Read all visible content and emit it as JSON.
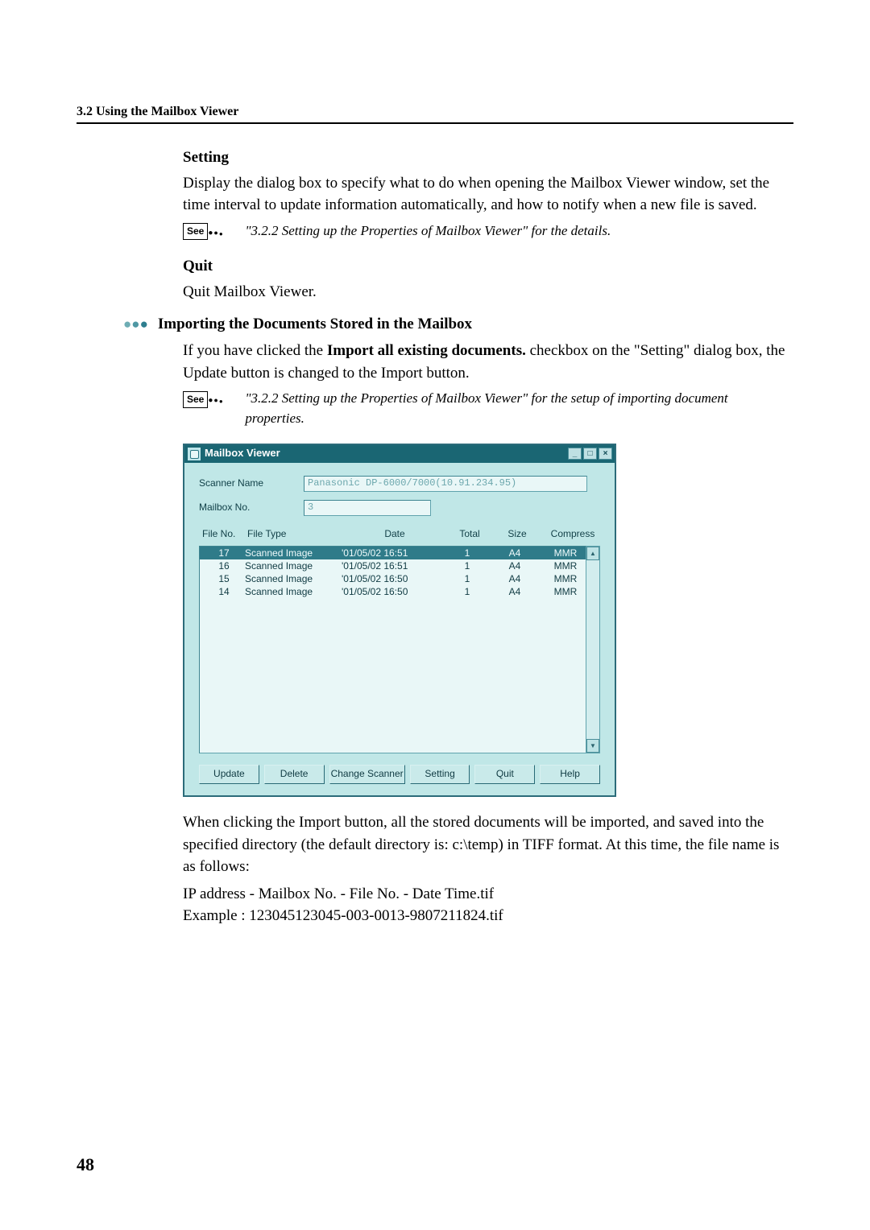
{
  "page": {
    "section_header": "3.2  Using the Mailbox Viewer",
    "page_number": "48"
  },
  "setting": {
    "heading": "Setting",
    "body": "Display the dialog box to specify what to do when opening the Mailbox Viewer window, set the time interval to update information automatically, and how to notify when a new file is saved.",
    "see_label": "See",
    "see_text": "\"3.2.2  Setting up the Properties of Mailbox Viewer\" for the details."
  },
  "quit": {
    "heading": "Quit",
    "body": "Quit Mailbox Viewer."
  },
  "importing": {
    "heading": "Importing the Documents Stored in the Mailbox",
    "body_pre": "If you have clicked the ",
    "body_bold": "Import all existing documents.",
    "body_post": " checkbox on the \"Setting\" dialog box, the Update button is changed to the Import button.",
    "see_label": "See",
    "see_text": "\"3.2.2  Setting up the Properties of Mailbox Viewer\" for the setup of  importing document properties."
  },
  "mbv": {
    "title": "Mailbox Viewer",
    "scanner_name_label": "Scanner Name",
    "scanner_name_value": "Panasonic DP-6000/7000(10.91.234.95)",
    "mailbox_no_label": "Mailbox No.",
    "mailbox_no_value": "3",
    "columns": {
      "file_no": "File No.",
      "file_type": "File Type",
      "date": "Date",
      "total": "Total",
      "size": "Size",
      "compress": "Compress"
    },
    "rows": [
      {
        "no": "17",
        "type": "Scanned Image",
        "date": "'01/05/02 16:51",
        "total": "1",
        "size": "A4",
        "compress": "MMR",
        "selected": true
      },
      {
        "no": "16",
        "type": "Scanned Image",
        "date": "'01/05/02 16:51",
        "total": "1",
        "size": "A4",
        "compress": "MMR",
        "selected": false
      },
      {
        "no": "15",
        "type": "Scanned Image",
        "date": "'01/05/02 16:50",
        "total": "1",
        "size": "A4",
        "compress": "MMR",
        "selected": false
      },
      {
        "no": "14",
        "type": "Scanned Image",
        "date": "'01/05/02 16:50",
        "total": "1",
        "size": "A4",
        "compress": "MMR",
        "selected": false
      }
    ],
    "buttons": {
      "update": "Update",
      "delete": "Delete",
      "change_scanner": "Change Scanner",
      "setting": "Setting",
      "quit": "Quit",
      "help": "Help"
    },
    "ctrl": {
      "min": "_",
      "max": "□",
      "close": "×"
    },
    "scroll": {
      "up": "▲",
      "down": "▼"
    }
  },
  "after": {
    "p1": "When clicking the Import button, all the stored documents will be imported, and saved into the specified directory (the default directory is: c:\\temp) in TIFF format. At this time, the file name is as follows:",
    "p2": "IP address - Mailbox No. - File No. - Date Time.tif",
    "p3": "Example : 123045123045-003-0013-9807211824.tif"
  }
}
